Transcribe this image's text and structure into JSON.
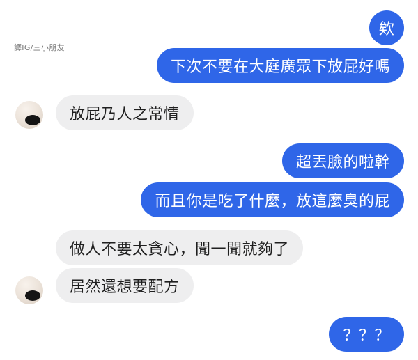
{
  "watermark": "譯IG/三小朋友",
  "messages": [
    {
      "id": "m1",
      "side": "outgoing",
      "text": "欸"
    },
    {
      "id": "m2",
      "side": "outgoing",
      "text": "下次不要在大庭廣眾下放屁好嗎"
    },
    {
      "id": "m3",
      "side": "incoming",
      "text": "放屁乃人之常情"
    },
    {
      "id": "m4",
      "side": "outgoing",
      "text": "超丟臉的啦幹"
    },
    {
      "id": "m5",
      "side": "outgoing",
      "text": "而且你是吃了什麼，放這麼臭的屁"
    },
    {
      "id": "m6",
      "side": "incoming",
      "text": "做人不要太貪心，聞一聞就夠了"
    },
    {
      "id": "m7",
      "side": "incoming",
      "text": "居然還想要配方"
    },
    {
      "id": "m8",
      "side": "outgoing",
      "text": "？？？"
    }
  ],
  "colors": {
    "outgoing_bubble": "#2f66e8",
    "incoming_bubble": "#eeeeef",
    "background": "#ffffff"
  },
  "icons": [
    "contact-avatar"
  ]
}
